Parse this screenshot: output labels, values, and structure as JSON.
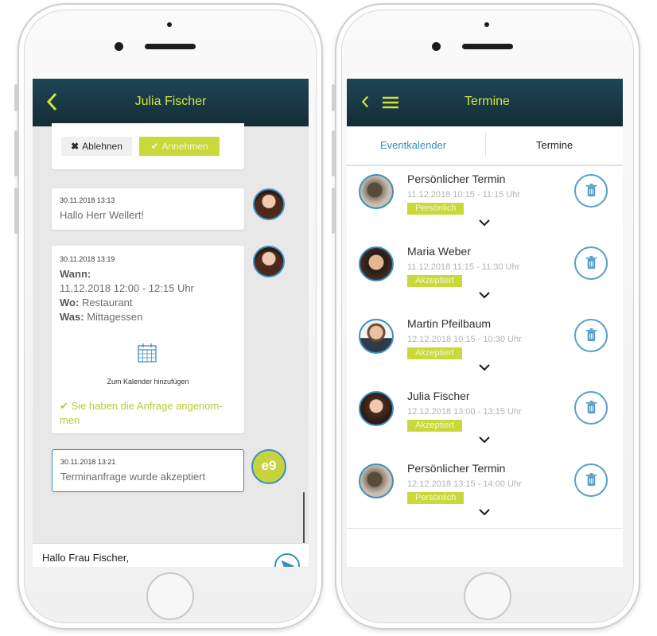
{
  "colors": {
    "header_dark": "#142c36",
    "accent_lime": "#c9d93a",
    "accent_blue": "#3b8fbf"
  },
  "left_screen": {
    "header": {
      "title": "Julia Fischer",
      "back_icon": "chevron-left-icon"
    },
    "invite_card": {
      "decline_label": "Ablehnen",
      "accept_label": "Annehmen"
    },
    "messages": [
      {
        "timestamp": "30.11.2018 13:13",
        "text": "Hallo Herr Wellert!"
      },
      {
        "timestamp": "30.11.2018 13:19",
        "when_label": "Wann:",
        "when_value": "11.12.2018 12:00 - 12:15 Uhr",
        "where_label": "Wo:",
        "where_value": "Restaurant",
        "what_label": "Was:",
        "what_value": "Mittagessen",
        "calendar_label": "Zum Kalender hinzufügen",
        "accepted_note": "Sie haben die Anfrage angenom-men"
      },
      {
        "timestamp": "30.11.2018 13:21",
        "text": "Terminanfrage wurde akzeptiert",
        "avatar_text": "e9"
      }
    ],
    "input": {
      "value": "Hallo Frau Fischer,"
    }
  },
  "right_screen": {
    "header": {
      "title": "Termine",
      "back_icon": "chevron-left-icon",
      "menu_icon": "hamburger-menu-icon"
    },
    "tabs": [
      {
        "label": "Eventkalender"
      },
      {
        "label": "Termine"
      }
    ],
    "appointments": [
      {
        "name": "Persönlicher Termin",
        "time": "11.12.2018 10:15 - 11:15 Uhr",
        "badge": "Persönlich"
      },
      {
        "name": "Maria Weber",
        "time": "11.12.2018 11:15 - 11:30 Uhr",
        "badge": "Akzeptiert"
      },
      {
        "name": "Martin Pfeilbaum",
        "time": "12.12.2018 10:15 - 10:30 Uhr",
        "badge": "Akzeptiert"
      },
      {
        "name": "Julia Fischer",
        "time": "12.12.2018 13:00 - 13:15 Uhr",
        "badge": "Akzeptiert"
      },
      {
        "name": "Persönlicher Termin",
        "time": "12.12.2018 13:15 - 14:00 Uhr",
        "badge": "Persönlich"
      }
    ]
  }
}
